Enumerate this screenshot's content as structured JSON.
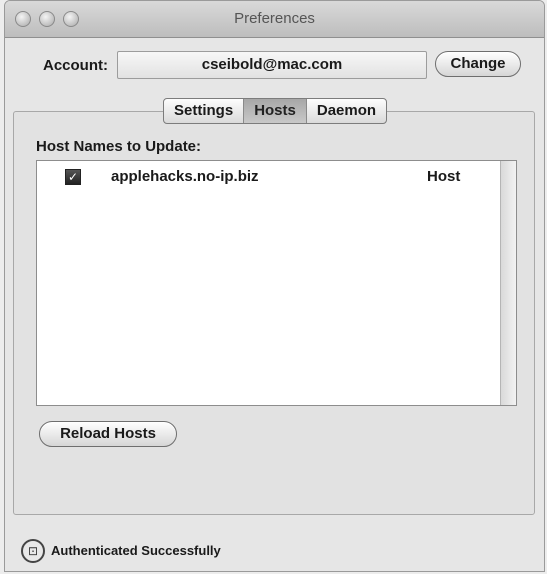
{
  "window": {
    "title": "Preferences"
  },
  "account": {
    "label": "Account:",
    "value": "cseibold@mac.com",
    "change_label": "Change"
  },
  "tabs": [
    {
      "label": "Settings",
      "active": false
    },
    {
      "label": "Hosts",
      "active": true
    },
    {
      "label": "Daemon",
      "active": false
    }
  ],
  "hosts": {
    "list_label": "Host Names to Update:",
    "rows": [
      {
        "name": "applehacks.no-ip.biz",
        "type": "Host",
        "checked": true
      }
    ],
    "reload_label": "Reload Hosts"
  },
  "status": {
    "text": "Authenticated Successfully",
    "icon": "lock-icon"
  }
}
